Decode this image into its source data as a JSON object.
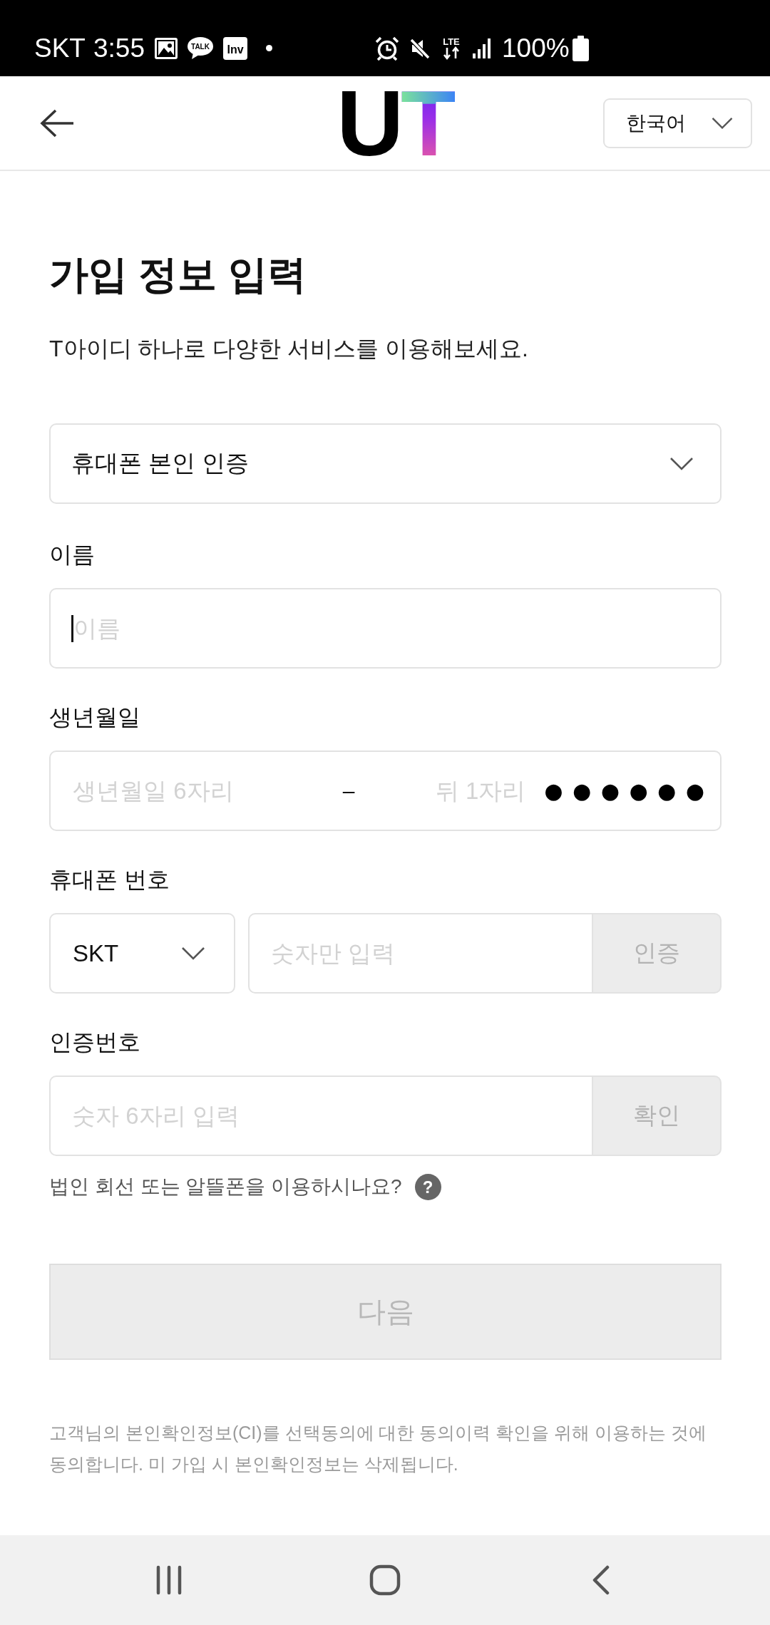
{
  "status_bar": {
    "carrier": "SKT",
    "time": "3:55",
    "notification_icons": [
      {
        "kind": "gallery"
      },
      {
        "kind": "talk",
        "label": "TALK"
      },
      {
        "kind": "app",
        "label": "Inv"
      },
      {
        "kind": "more"
      }
    ],
    "system_icons": [
      {
        "kind": "alarm"
      },
      {
        "kind": "mute"
      },
      {
        "kind": "lte",
        "label": "LTE"
      },
      {
        "kind": "signal"
      }
    ],
    "battery": "100%"
  },
  "header": {
    "logo": "UT",
    "language": "한국어"
  },
  "title": "가입 정보 입력",
  "subtitle": "T아이디 하나로 다양한 서비스를 이용해보세요.",
  "auth_method": {
    "value": "휴대폰 본인 인증"
  },
  "name": {
    "label": "이름",
    "placeholder": "이름",
    "focused": true
  },
  "birthdate": {
    "label": "생년월일",
    "placeholder": "생년월일 6자리",
    "separator": "–",
    "id_placeholder": "뒤 1자리",
    "mask": "● ● ● ● ● ●"
  },
  "phone": {
    "label": "휴대폰 번호",
    "carrier": "SKT",
    "placeholder": "숫자만 입력",
    "button": "인증",
    "button_disabled": true
  },
  "verification": {
    "label": "인증번호",
    "placeholder": "숫자 6자리 입력",
    "button": "확인",
    "button_disabled": true
  },
  "help": {
    "text": "법인 회선 또는 알뜰폰을 이용하시나요?",
    "icon": "?"
  },
  "next_button": {
    "label": "다음",
    "disabled": true
  },
  "consent_note": "고객님의 본인확인정보(CI)를 선택동의에 대한 동의이력 확인을 위해 이용하는 것에 동의합니다. 미 가입 시 본인확인정보는 삭제됩니다.",
  "nav_bar": {
    "buttons": [
      {
        "kind": "recents"
      },
      {
        "kind": "home"
      },
      {
        "kind": "back"
      }
    ]
  }
}
